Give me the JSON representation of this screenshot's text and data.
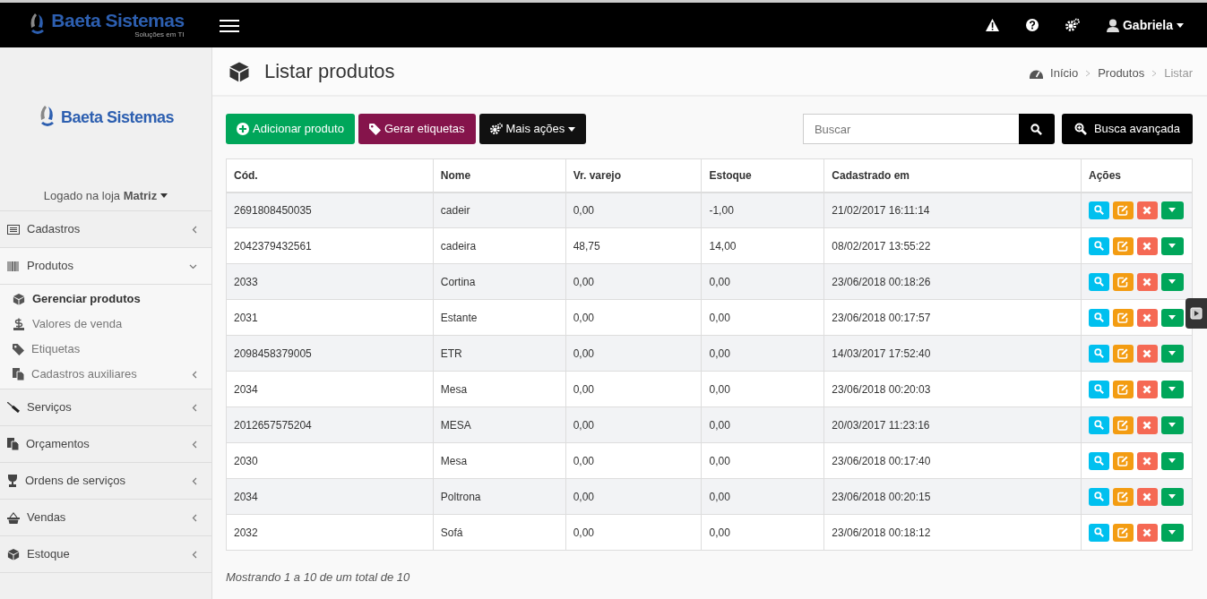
{
  "topbar": {
    "brand": "Baeta Sistemas",
    "tagline": "Soluções em TI",
    "user": "Gabriela"
  },
  "sidebar": {
    "brand": "Baeta Sistemas",
    "store": "Logado na loja **Matriz**",
    "items": [
      {
        "label": "Cadastros",
        "expanded": false
      },
      {
        "label": "Produtos",
        "expanded": true,
        "children": [
          {
            "label": "Gerenciar produtos",
            "selected": true,
            "expandable": false
          },
          {
            "label": "Valores de venda",
            "selected": false,
            "expandable": false
          },
          {
            "label": "Etiquetas",
            "selected": false,
            "expandable": false
          },
          {
            "label": "Cadastros auxiliares",
            "selected": false,
            "expandable": true
          }
        ]
      },
      {
        "label": "Serviços",
        "expanded": false
      },
      {
        "label": "Orçamentos",
        "expanded": false
      },
      {
        "label": "Ordens de serviços",
        "expanded": false
      },
      {
        "label": "Vendas",
        "expanded": false
      },
      {
        "label": "Estoque",
        "expanded": false
      }
    ]
  },
  "page": {
    "title": "Listar produtos",
    "breadcrumb": [
      {
        "label": "Início",
        "current": false
      },
      {
        "label": "Produtos",
        "current": false
      },
      {
        "label": "Listar",
        "current": true
      }
    ]
  },
  "toolbar": {
    "buttons": [
      "Adicionar produto",
      "Gerar etiquetas",
      "Mais ações"
    ],
    "search": {
      "placeholder": "Buscar"
    },
    "advanced": "Busca avançada"
  },
  "table": {
    "columns": [
      "Cód.",
      "Nome",
      "Vr. varejo",
      "Estoque",
      "Cadastrado em",
      "Ações"
    ],
    "rows": [
      [
        "2691808450035",
        "cadeir",
        "0,00",
        "-1,00",
        "21/02/2017 16:11:14"
      ],
      [
        "2042379432561",
        "cadeira",
        "48,75",
        "14,00",
        "08/02/2017 13:55:22"
      ],
      [
        "2033",
        "Cortina",
        "0,00",
        "0,00",
        "23/06/2018 00:18:26"
      ],
      [
        "2031",
        "Estante",
        "0,00",
        "0,00",
        "23/06/2018 00:17:57"
      ],
      [
        "2098458379005",
        "ETR",
        "0,00",
        "0,00",
        "14/03/2017 17:52:40"
      ],
      [
        "2034",
        "Mesa",
        "0,00",
        "0,00",
        "23/06/2018 00:20:03"
      ],
      [
        "2012657575204",
        "MESA",
        "0,00",
        "0,00",
        "20/03/2017 11:23:16"
      ],
      [
        "2030",
        "Mesa",
        "0,00",
        "0,00",
        "23/06/2018 00:17:40"
      ],
      [
        "2034",
        "Poltrona",
        "0,00",
        "0,00",
        "23/06/2018 00:20:15"
      ],
      [
        "2032",
        "Sofá",
        "0,00",
        "0,00",
        "23/06/2018 00:18:12"
      ]
    ]
  },
  "footer": "Mostrando 1 a 10 de um total de 10"
}
